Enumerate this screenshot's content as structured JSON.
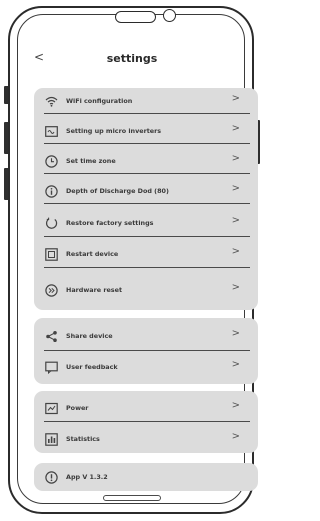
{
  "header": {
    "title": "settings",
    "back_glyph": "<"
  },
  "groups": [
    {
      "items": [
        {
          "label": "WiFi configuration",
          "icon": "wifi-icon"
        },
        {
          "label": "Setting up micro inverters",
          "icon": "inverter-icon"
        },
        {
          "label": "Set time zone",
          "icon": "clock-icon"
        },
        {
          "label": "Depth of Discharge Dod (80)",
          "icon": "info-icon"
        },
        {
          "label": "Restore factory settings",
          "icon": "restore-icon"
        },
        {
          "label": "Restart device",
          "icon": "restart-icon"
        },
        {
          "label": "Hardware reset",
          "icon": "hardware-reset-icon"
        }
      ]
    },
    {
      "items": [
        {
          "label": "Share device",
          "icon": "share-icon"
        },
        {
          "label": "User feedback",
          "icon": "feedback-icon"
        }
      ]
    },
    {
      "items": [
        {
          "label": "Power",
          "icon": "power-icon"
        },
        {
          "label": "Statistics",
          "icon": "statistics-icon"
        }
      ]
    },
    {
      "items": [
        {
          "label": "App V 1.3.2",
          "icon": "app-info-icon"
        }
      ]
    }
  ],
  "chevron_glyph": ">"
}
